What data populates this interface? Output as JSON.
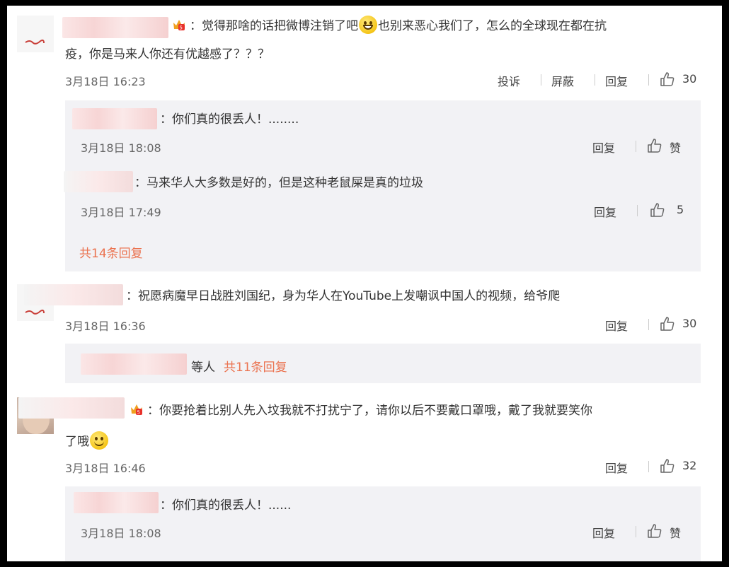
{
  "comments": [
    {
      "text_line1": "：觉得那啥的话把微博注销了吧",
      "text_line1b": "也别来恶心我们了，怎么的全球现在都在抗",
      "text_line2": "疫，你是马来人你还有优越感了？？？",
      "date": "3月18日 16:23",
      "actions": [
        "投诉",
        "屏蔽",
        "回复"
      ],
      "likes": "30",
      "replies": [
        {
          "text": "：你们真的很丢人！........",
          "date": "3月18日 18:08",
          "action": "回复",
          "likes": "赞"
        },
        {
          "text": "：马来华人大多数是好的，但是这种老鼠屎是真的垃圾",
          "date": "3月18日 17:49",
          "action": "回复",
          "likes": "5"
        }
      ],
      "more_label": "共14条回复"
    },
    {
      "text_line1": "：祝愿病魔早日战胜刘国纪，身为华人在YouTube上发嘲讽中国人的视频，给爷爬",
      "date": "3月18日 16:36",
      "actions": [
        "回复"
      ],
      "likes": "30",
      "summary_text": "等人",
      "more_label": "共11条回复"
    },
    {
      "text_line1": "：你要抢着比别人先入坟我就不打扰宁了，请你以后不要戴口罩哦，戴了我就要笑你",
      "text_line2": "了哦",
      "date": "3月18日 16:46",
      "actions": [
        "回复"
      ],
      "likes": "32",
      "replies": [
        {
          "text": "：你们真的很丢人！......",
          "date": "3月18日 18:08",
          "action": "回复",
          "likes": "赞"
        }
      ]
    }
  ],
  "icons": {
    "like": "thumbs-up-icon",
    "vip_badge": "crown-badge-icon",
    "emoji_grin": "grin-emoji",
    "emoji_smile": "smile-emoji"
  },
  "colors": {
    "accent": "#eb7350",
    "reply_bg": "#f2f2f5",
    "text": "#333333"
  }
}
